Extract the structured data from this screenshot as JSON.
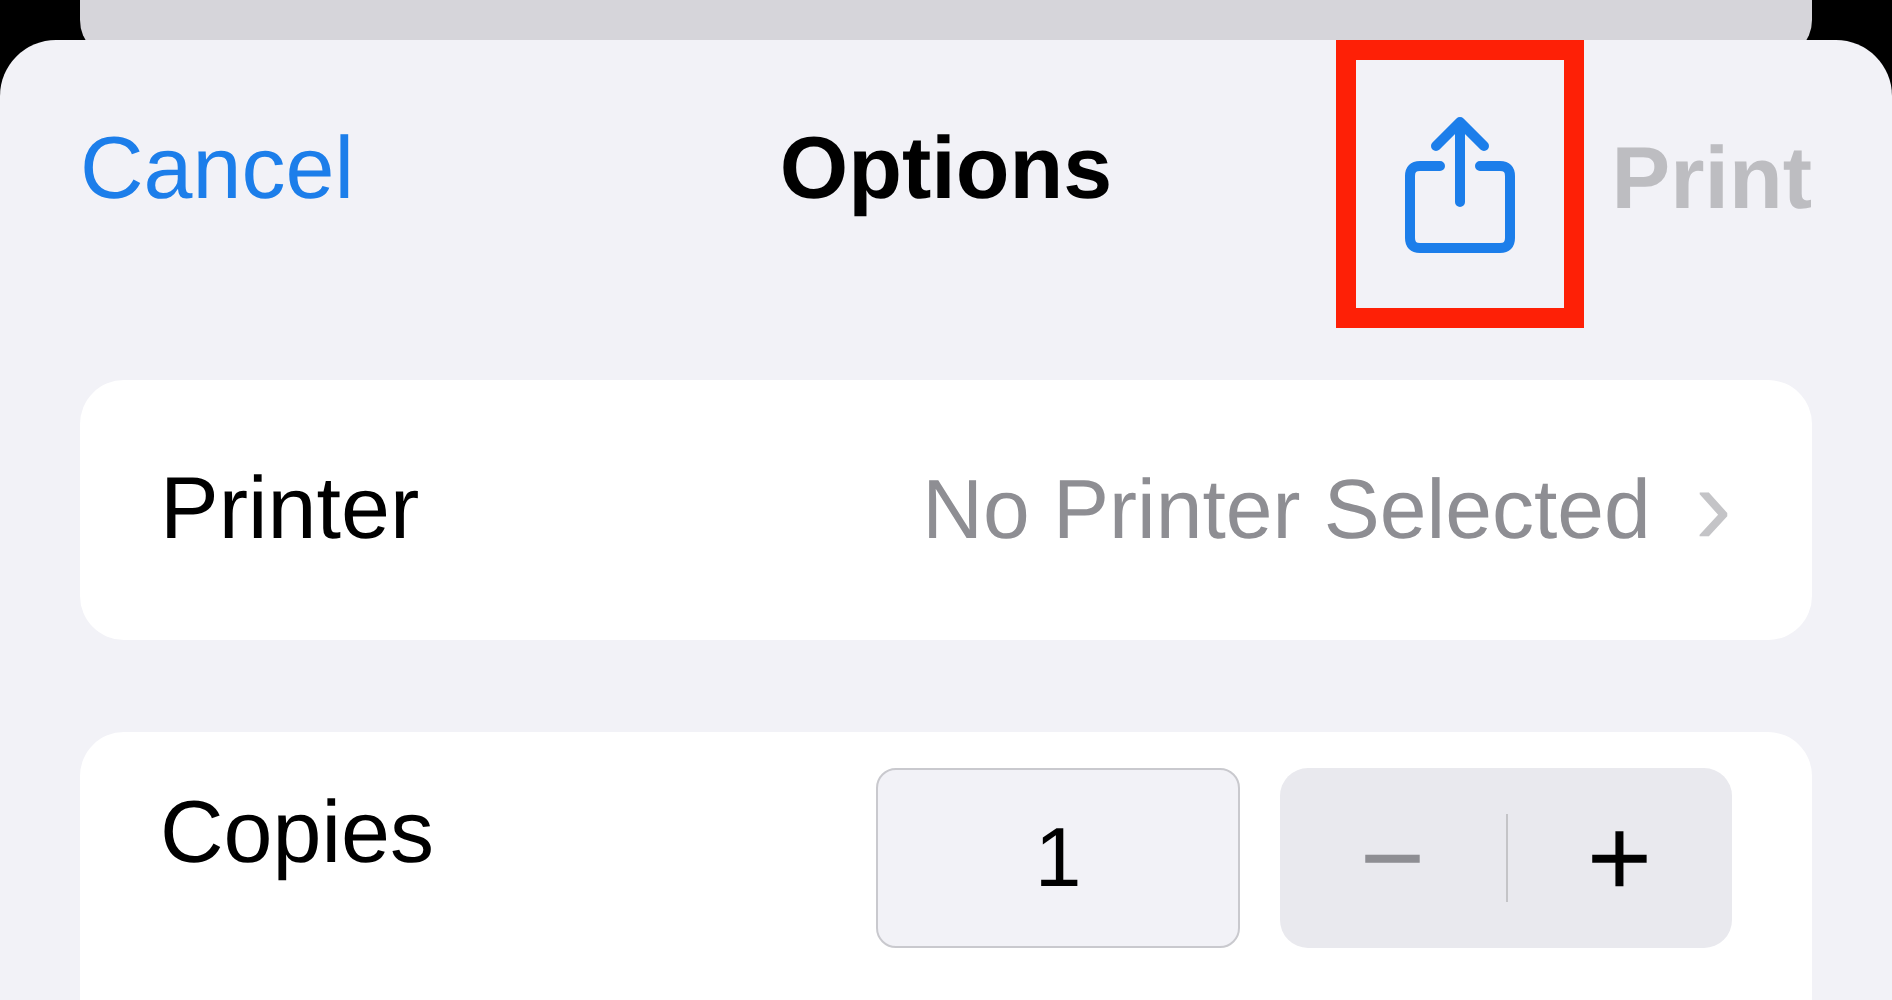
{
  "nav": {
    "cancel": "Cancel",
    "title": "Options",
    "share": {
      "highlighted": true
    },
    "print": {
      "label": "Print",
      "disabled": true
    }
  },
  "printer": {
    "label": "Printer",
    "value": "No Printer Selected",
    "chevron": "›"
  },
  "copies": {
    "label": "Copies",
    "value": "1",
    "minus": "−",
    "plus": "+"
  }
}
